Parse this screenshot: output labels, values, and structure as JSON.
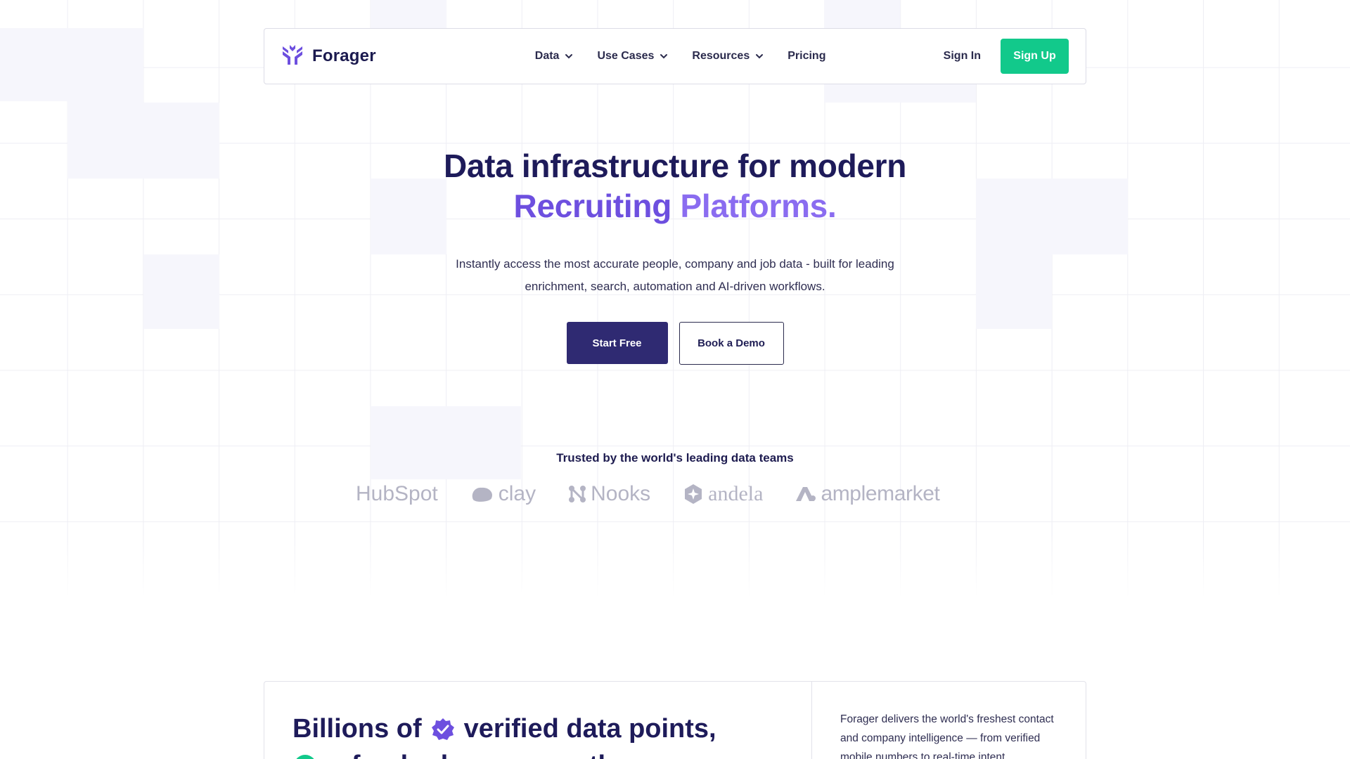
{
  "brand": {
    "name": "Forager",
    "accent_color": "#6d4fdf"
  },
  "nav": {
    "items": [
      {
        "label": "Data",
        "has_dropdown": true
      },
      {
        "label": "Use Cases",
        "has_dropdown": true
      },
      {
        "label": "Resources",
        "has_dropdown": true
      },
      {
        "label": "Pricing",
        "has_dropdown": false
      }
    ],
    "sign_in": "Sign In",
    "sign_up": "Sign Up",
    "sign_up_color": "#12c98b"
  },
  "hero": {
    "title_line1": "Data infrastructure for modern",
    "title_accent1": "Recruiting",
    "title_accent2": "Platforms.",
    "subtitle_line1": "Instantly access the most accurate people, company and job data - built for leading",
    "subtitle_line2": "enrichment, search, automation and AI-driven workflows.",
    "primary_cta": "Start Free",
    "secondary_cta": "Book a Demo"
  },
  "trusted": {
    "heading": "Trusted by the world's leading data teams",
    "logos": [
      "HubSpot",
      "clay",
      "Nooks",
      "andela",
      "amplemarket"
    ]
  },
  "section": {
    "title": "Billions of",
    "title_after": "verified data points,",
    "title_line2": "refreshed every month.",
    "description": "Forager delivers the world's freshest contact and company intelligence — from verified mobile numbers to real-time intent"
  }
}
